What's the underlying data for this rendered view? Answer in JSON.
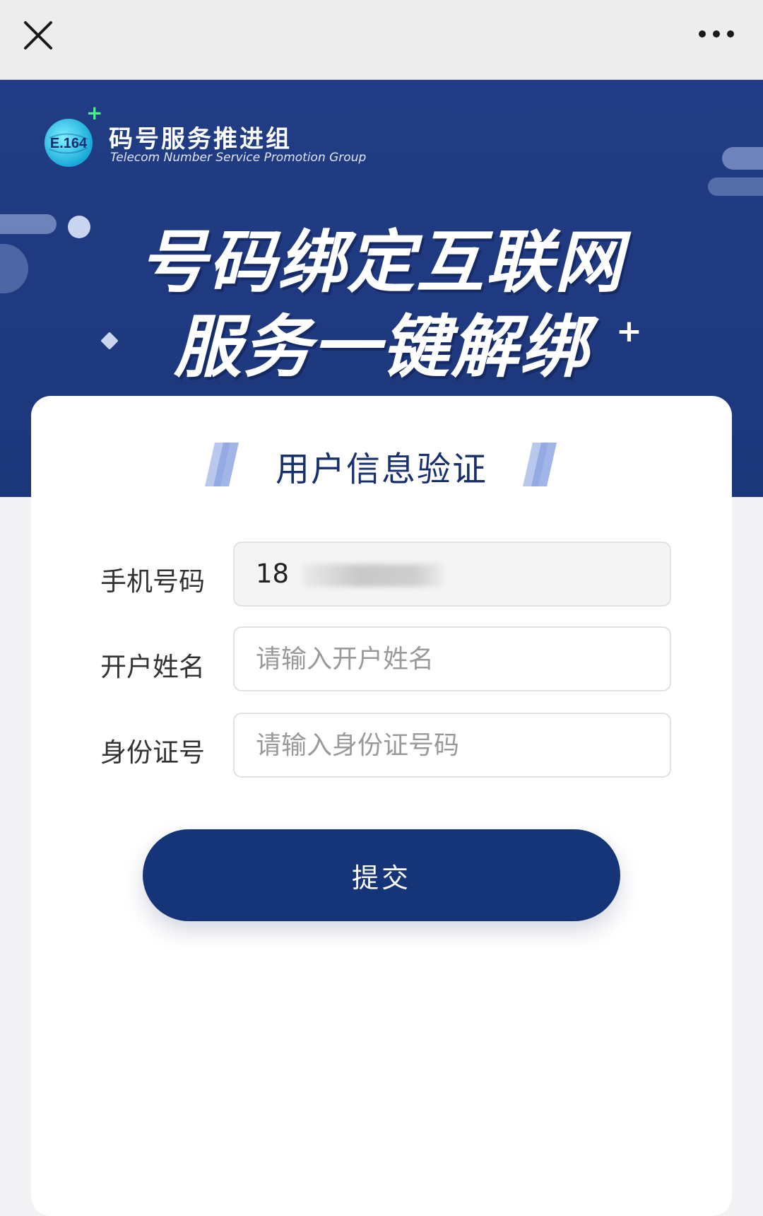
{
  "topbar": {
    "close_icon": "close-icon",
    "more_icon": "more-horizontal-icon"
  },
  "banner": {
    "logo_text": "E.164",
    "org_name": "码号服务推进组",
    "org_name_en": "Telecom Number Service  Promotion Group",
    "headline_line1": "号码绑定互联网",
    "headline_line2": "服务一键解绑"
  },
  "form": {
    "title": "用户信息验证",
    "phone": {
      "label": "手机号码",
      "value": "18"
    },
    "name": {
      "label": "开户姓名",
      "placeholder": "请输入开户姓名"
    },
    "id_number": {
      "label": "身份证号",
      "placeholder": "请输入身份证号码"
    },
    "submit_label": "提交"
  },
  "colors": {
    "brand_dark": "#163578",
    "banner_bg": "#213c84",
    "title_color": "#17316f"
  }
}
